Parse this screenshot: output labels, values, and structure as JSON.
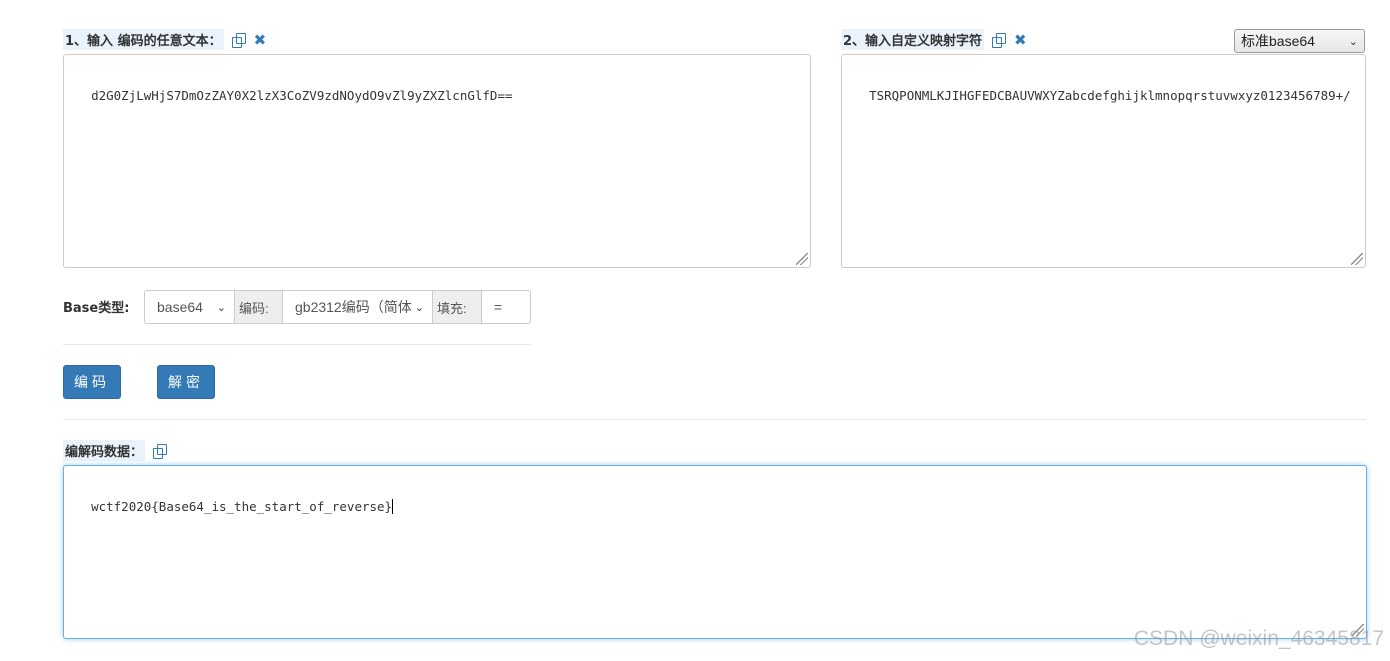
{
  "input": {
    "label": "1、输入 编码的任意文本：",
    "value": "d2G0ZjLwHjS7DmOzZAY0X2lzX3CoZV9zdNOydO9vZl9yZXZlcnGlfD=="
  },
  "mapping": {
    "label": "2、输入自定义映射字符",
    "value": "TSRQPONMLKJIHGFEDCBAUVWXYZabcdefghijklmnopqrstuvwxyz0123456789+/",
    "preset_select": "标准base64"
  },
  "options": {
    "base_type_label": "Base类型:",
    "base_type_value": "base64",
    "encoding_label": "编码:",
    "encoding_value": "gb2312编码（简体",
    "padding_label": "填充:",
    "padding_value": "="
  },
  "buttons": {
    "encode": "编码",
    "decode": "解密"
  },
  "output": {
    "label": "编解码数据：",
    "value": "wctf2020{Base64_is_the_start_of_reverse}"
  },
  "watermark": "CSDN @weixin_46345817",
  "colors": {
    "primary": "#337ab7",
    "label_bg": "#eaf2fb",
    "focus_border": "#66afe9"
  }
}
